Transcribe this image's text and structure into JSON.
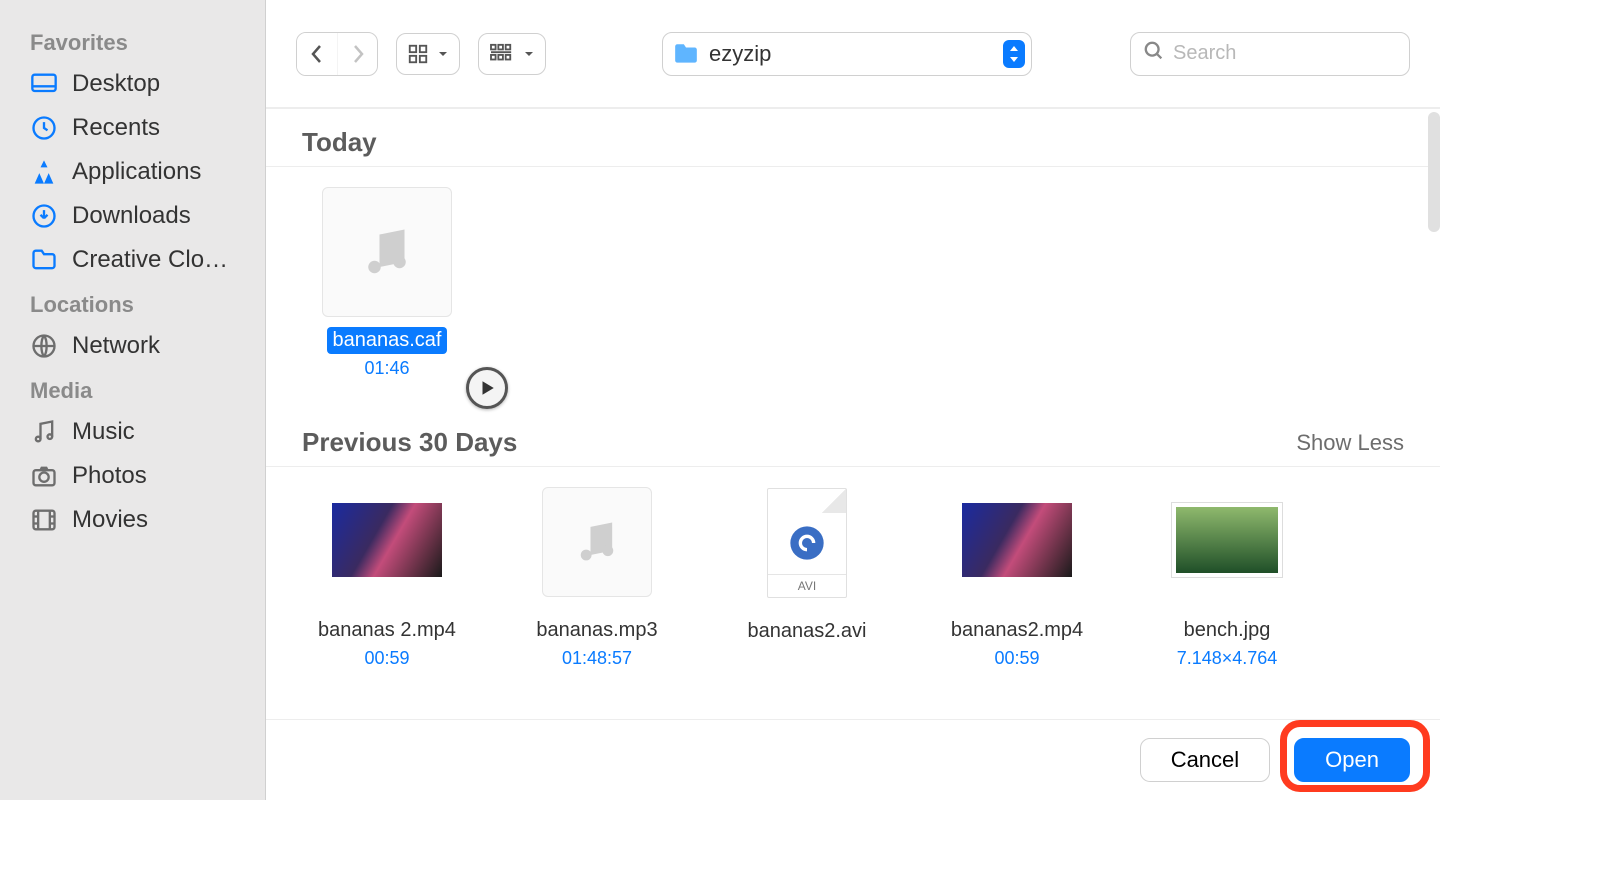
{
  "sidebar": {
    "sections": {
      "favorites": {
        "title": "Favorites",
        "items": [
          {
            "label": "Desktop"
          },
          {
            "label": "Recents"
          },
          {
            "label": "Applications"
          },
          {
            "label": "Downloads"
          },
          {
            "label": "Creative Clo…"
          }
        ]
      },
      "locations": {
        "title": "Locations",
        "items": [
          {
            "label": "Network"
          }
        ]
      },
      "media": {
        "title": "Media",
        "items": [
          {
            "label": "Music"
          },
          {
            "label": "Photos"
          },
          {
            "label": "Movies"
          }
        ]
      }
    }
  },
  "toolbar": {
    "path_label": "ezyzip",
    "search_placeholder": "Search"
  },
  "groups": {
    "today": {
      "title": "Today",
      "files": [
        {
          "name": "bananas.caf",
          "meta": "01:46",
          "selected": true,
          "kind": "audio"
        }
      ]
    },
    "prev30": {
      "title": "Previous 30 Days",
      "show_less": "Show Less",
      "files": [
        {
          "name": "bananas 2.mp4",
          "meta": "00:59",
          "kind": "video"
        },
        {
          "name": "bananas.mp3",
          "meta": "01:48:57",
          "kind": "audio"
        },
        {
          "name": "bananas2.avi",
          "meta": "",
          "kind": "avi"
        },
        {
          "name": "bananas2.mp4",
          "meta": "00:59",
          "kind": "video"
        },
        {
          "name": "bench.jpg",
          "meta": "7.148×4.764",
          "kind": "image"
        }
      ]
    }
  },
  "footer": {
    "cancel": "Cancel",
    "open": "Open"
  },
  "icons": {
    "avi_label": "AVI"
  },
  "colors": {
    "accent": "#0a7bff",
    "highlight": "#ff3b1f"
  }
}
